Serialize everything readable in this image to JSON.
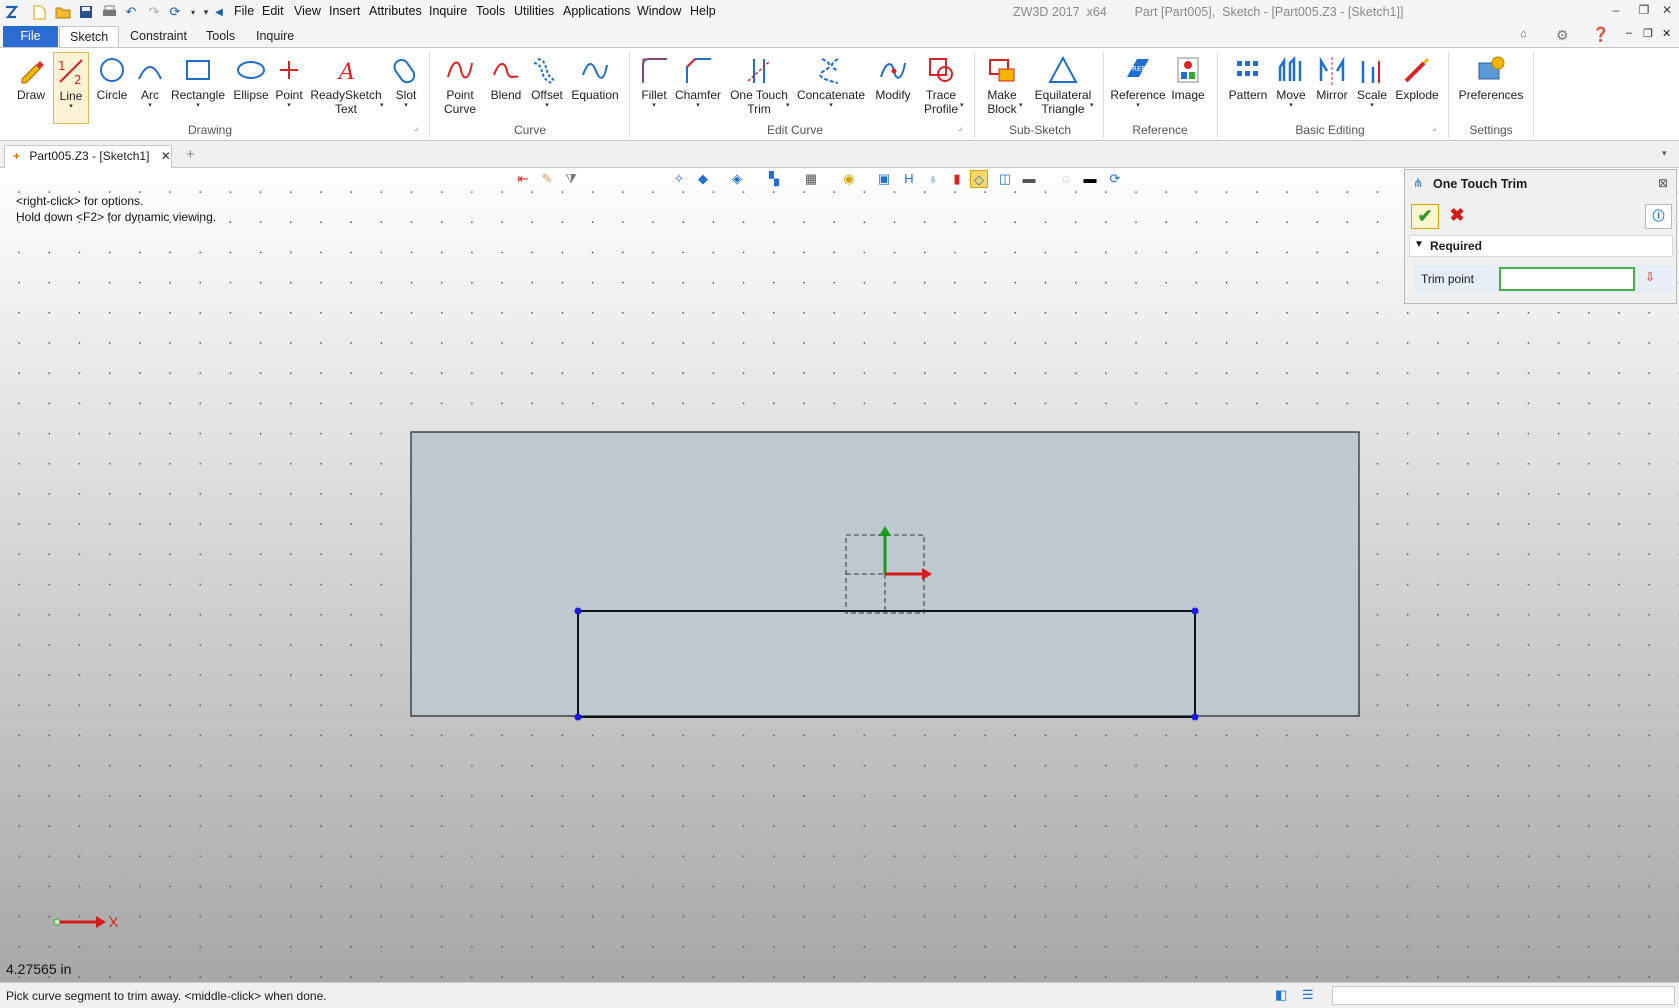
{
  "app": {
    "title": "ZW3D 2017  x64        Part [Part005],  Sketch - [Part005.Z3 - [Sketch1]]"
  },
  "menu": [
    "File",
    "Edit",
    "View",
    "Insert",
    "Attributes",
    "Inquire",
    "Tools",
    "Utilities",
    "Applications",
    "Window",
    "Help"
  ],
  "ribbon_tabs": [
    "File",
    "Sketch",
    "Constraint",
    "Tools",
    "Inquire"
  ],
  "ribbon": {
    "drawing": {
      "label": "Drawing",
      "draw": "Draw",
      "line": "Line",
      "circle": "Circle",
      "arc": "Arc",
      "rectangle": "Rectangle",
      "ellipse": "Ellipse",
      "point": "Point",
      "readysketch_1": "ReadySketch",
      "readysketch_2": "Text",
      "slot": "Slot"
    },
    "curve": {
      "label": "Curve",
      "point_curve_1": "Point",
      "point_curve_2": "Curve",
      "blend": "Blend",
      "offset": "Offset",
      "equation": "Equation"
    },
    "edit_curve": {
      "label": "Edit Curve",
      "fillet": "Fillet",
      "chamfer": "Chamfer",
      "one_touch_1": "One Touch",
      "one_touch_2": "Trim",
      "concatenate": "Concatenate",
      "modify": "Modify",
      "trace_1": "Trace",
      "trace_2": "Profile"
    },
    "sub_sketch": {
      "label": "Sub-Sketch",
      "make_block_1": "Make",
      "make_block_2": "Block",
      "eq_tri_1": "Equilateral",
      "eq_tri_2": "Triangle"
    },
    "reference": {
      "label": "Reference",
      "reference": "Reference",
      "image": "Image"
    },
    "basic_editing": {
      "label": "Basic Editing",
      "pattern": "Pattern",
      "move": "Move",
      "mirror": "Mirror",
      "scale": "Scale",
      "explode": "Explode"
    },
    "settings": {
      "label": "Settings",
      "preferences": "Preferences"
    }
  },
  "doc_tab": {
    "label": "Part005.Z3 - [Sketch1]",
    "add": "+"
  },
  "canvas": {
    "hint1": "<right-click> for options.",
    "hint2": "Hold down <F2> for dynamic viewing.",
    "units": "4.27565 in",
    "axis_label": "X"
  },
  "panel": {
    "title": "One Touch Trim",
    "section": "Required",
    "field_label": "Trim point",
    "field_value": ""
  },
  "status": {
    "prompt": "Pick curve segment to trim away.  <middle-click> when done."
  }
}
